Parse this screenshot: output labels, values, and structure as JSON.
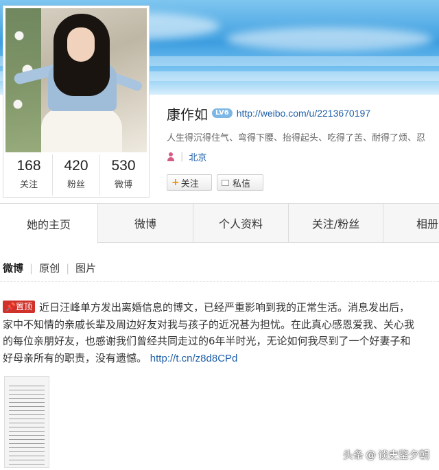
{
  "profile": {
    "name": "康作如",
    "vip_badge": "LV6",
    "url": "http://weibo.com/u/2213670197",
    "bio": "人生得沉得住气、弯得下腰、抬得起头、吃得了苦、耐得了烦、忍",
    "location": "北京",
    "location_icon": "person-icon"
  },
  "stats": [
    {
      "value": "168",
      "label": "关注"
    },
    {
      "value": "420",
      "label": "粉丝"
    },
    {
      "value": "530",
      "label": "微博"
    }
  ],
  "actions": {
    "follow_label": "关注",
    "follow_prefix": "+",
    "message_label": "私信"
  },
  "nav_tabs": [
    "她的主页",
    "微博",
    "个人资料",
    "关注/粉丝",
    "相册"
  ],
  "sub_tabs": [
    "微博",
    "原创",
    "图片"
  ],
  "post": {
    "pin_label": "置顶",
    "lines": [
      "近日汪峰单方发出离婚信息的博文，已经严重影响到我的正常生活。消息发出后，",
      "家中不知情的亲戚长辈及周边好友对我与孩子的近况甚为担忧。在此真心感恩爱我、关心我",
      "的每位亲朋好友，也感谢我们曾经共同走过的6年半时光，无论如何我尽到了一个好妻子和",
      "好母亲所有的职责，没有遗憾。"
    ],
    "link": "http://t.cn/z8d8CPd"
  },
  "watermark": {
    "prefix": "头条",
    "at": "@",
    "handle": "谈史鉴夕朝"
  },
  "colors": {
    "link": "#1e5fa8",
    "pin": "#d1312b",
    "follow_plus": "#f08a00",
    "location_icon": "#d45b86"
  }
}
